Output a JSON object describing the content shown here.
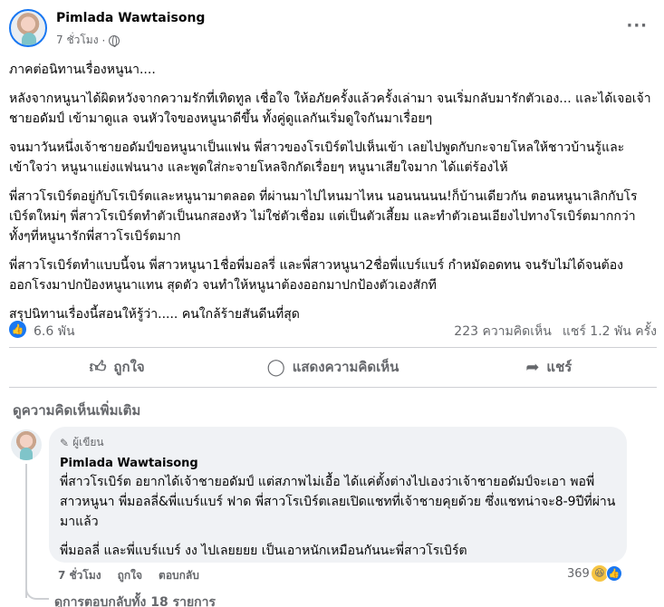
{
  "post": {
    "author": "Pimlada Wawtaisong",
    "time": "7 ชั่วโมง",
    "paragraphs": [
      "ภาคต่อนิทานเรื่องหนูนา....",
      "หลังจากหนูนาได้ผิดหวังจากความรักที่เทิดทูล เชื่อใจ ให้อภัยครั้งแล้วครั้งเล่ามา จนเริ่มกลับมารักตัวเอง... และได้เจอเจ้าชายอดัมป์ เข้ามาดูแล จนหัวใจของหนูนาดีขึ้น ทั้งคู่ดูแลกันเริ่มดูใจกันมาเรื่อยๆ",
      "จนมาวันหนึ่งเจ้าชายอดัมป์ขอหนูนาเป็นแฟน พี่สาวของโรเบิร์ตไปเห็นเข้า เลยไปพูดกับกะจายโหลให้ชาวบ้านรู้และเข้าใจว่า หนูนาแย่งแฟนนาง และพูดใส่กะจายโหลจิกกัดเรื่อยๆ  หนูนาเสียใจมาก ได้แต่ร้องไห้",
      "พี่สาวโรเบิร์ตอยู่กับโรเบิร์ตและหนูนามาตลอด ที่ผ่านมาไปไหนมาไหน นอนนนนน!ก็บ้านเดียวกัน ตอนหนูนาเลิกกับโรเบิร์ตใหม่ๆ พี่สาวโรเบิร์ตทำตัวเป็นนกสองหัว ไม่ใช่ตัวเชื่อม แต่เป็นตัวเสี้ยม และทำตัวเอนเอียงไปทางโรเบิร์ตมากกว่า ทั้งๆที่หนูนารักพี่สาวโรเบิร์ตมาก",
      "พี่สาวโรเบิร์ตทำแบบนี้จน พี่สาวหนูนา1ชื่อพี่มอลรี่ และพี่สาวหนูนา2ชื่อพี่แบร์แบร์ กำหมัดอดทน จนรับไม่ได้จนต้องออกโรงมาปกป้องหนูนาแทน สุดตัว จนทำให้หนูนาต้องออกมาปกป้องตัวเองสักที",
      "สรุปนิทานเรื่องนี้สอนให้รู้ว่า..... คนใกล้ร้ายสันดีนที่สุด"
    ],
    "likes": "6.6 พัน",
    "comments_count": "223 ความคิดเห็น",
    "shares_count": "แชร์ 1.2 พัน ครั้ง"
  },
  "actions": {
    "like": "ถูกใจ",
    "comment": "แสดงความคิดเห็น",
    "share": "แชร์"
  },
  "comments_section": {
    "view_more": "ดูความคิดเห็นเพิ่มเติม",
    "comment": {
      "badge": "ผู้เขียน",
      "author": "Pimlada Wawtaisong",
      "text1": "พี่สาวโรเบิร์ต อยากได้เจ้าชายอดัมป์ แต่สภาพไม่เอื้อ ได้แค่ตั้งต่างไปเองว่าเจ้าชายอดัมป์จะเอา พอพี่สาวหนูนา พี่มอลลี่&พี่แบร์แบร์ ฟาด พี่สาวโรเบิร์ตเลยเปิดแชทที่เจ้าชายคุยด้วย ซึ่งแชทน่าจะ8-9ปีที่ผ่านมาแล้ว",
      "text2": "พี่มอลลี่ และพี่แบร์แบร์ งง ไปเลยยยย เป็นเอาหนักเหมือนกันนะพี่สาวโรเบิร์ต",
      "time": "7 ชั่วโมง",
      "like": "ถูกใจ",
      "reply": "ตอบกลับ",
      "reactions": "369"
    },
    "all_replies": "ดูการตอบกลับทั้ง 18 รายการ"
  }
}
